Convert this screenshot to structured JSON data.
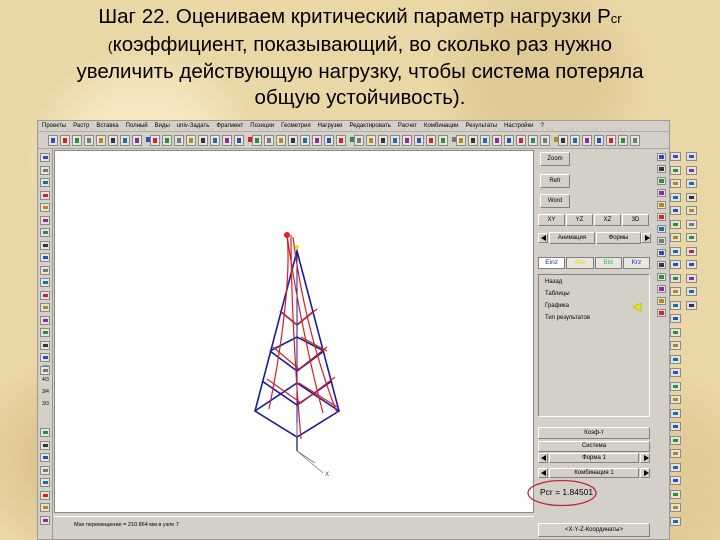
{
  "slide": {
    "title_main": "Шаг 22.",
    "title_rest": " Оцениваем критический параметр нагрузки P",
    "title_sub": "cr",
    "title_paren": "(",
    "title_line2": "коэффициент, показывающий, во сколько раз нужно",
    "title_line3": "увеличить действующую нагрузку, чтобы система потеряла",
    "title_line4": "общую устойчивость)."
  },
  "menu": [
    "Проекты",
    "Растр",
    "Вставка",
    "Полный",
    "Виды",
    "univ-Задать",
    "Фрагмент",
    "Позиции",
    "Геометрия",
    "Нагрузки",
    "Редактировать",
    "Расчет",
    "Комбинации",
    "Результаты",
    "Настройки",
    "?"
  ],
  "left_labels": [
    "4/3",
    "4/3",
    "3/4",
    "3/3"
  ],
  "panel": {
    "zoom": "Zoom",
    "refr": "Refr",
    "word": "Word",
    "views": [
      "XY",
      "YZ",
      "XZ",
      "3D"
    ],
    "animation": "Анимация",
    "forms": "Формы",
    "tabs": [
      {
        "label": "Einz",
        "color": "#1f2ad0"
      },
      {
        "label": "Alle",
        "color": "#e0e000"
      },
      {
        "label": "Bld",
        "color": "#2dc832"
      },
      {
        "label": "Krz",
        "color": "#1f2ad0"
      }
    ],
    "list": [
      "Назад",
      "Таблицы",
      "Графика",
      "Тип результатов"
    ],
    "koef": "Коэф-т",
    "sistema": "Система",
    "forma": "Форма 1",
    "kombinaciya": "Комбинация 1",
    "pcr": "Pcr = 1.84501",
    "coords": "<X-Y-Z-Координаты>"
  },
  "status": "Max перемещение = 210.864 мм в узле 7",
  "colors": {
    "original": "#1a1aa0",
    "deformed": "#d42020",
    "highlight": "#c0283c",
    "pointer": "#e8e800"
  }
}
